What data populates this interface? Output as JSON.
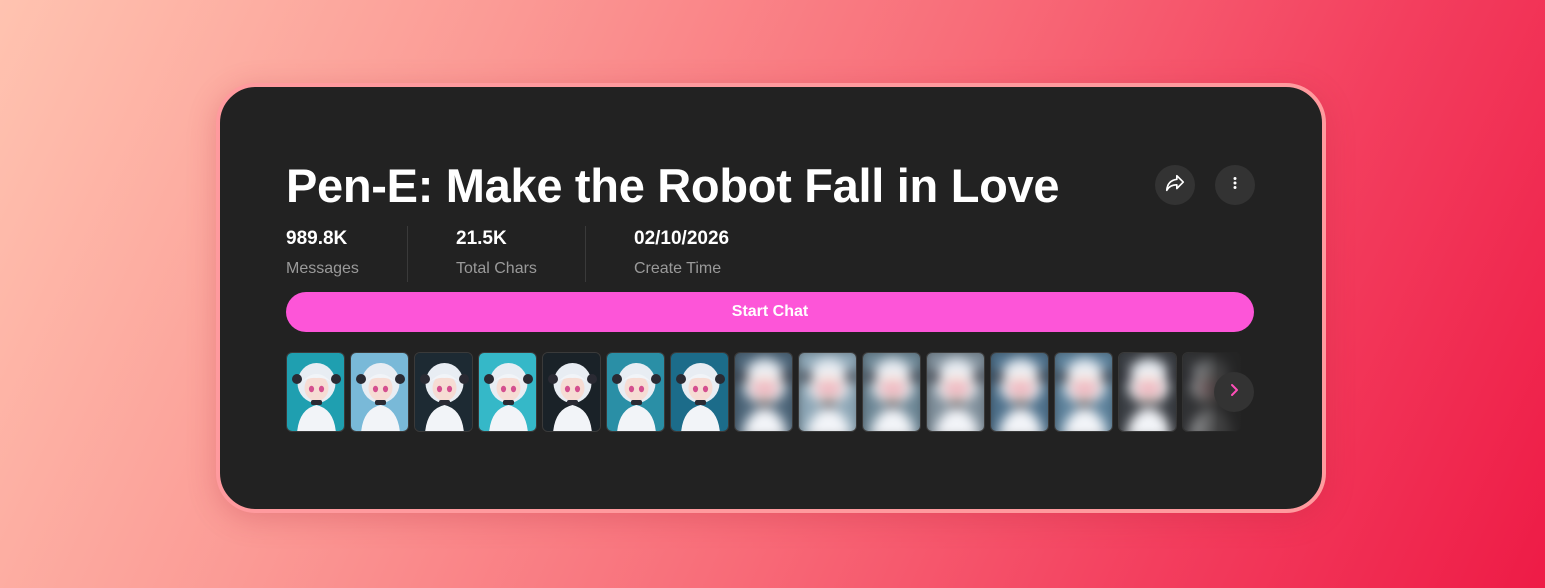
{
  "title": "Pen-E: Make the Robot Fall in Love",
  "actions": {
    "share_icon": "share-icon",
    "more_icon": "more-vertical-icon"
  },
  "stats": [
    {
      "value": "989.8K",
      "label": "Messages"
    },
    {
      "value": "21.5K",
      "label": "Total Chars"
    },
    {
      "value": "02/10/2026",
      "label": "Create Time"
    }
  ],
  "start_button": {
    "label": "Start Chat"
  },
  "gallery": {
    "next_icon": "chevron-right-icon",
    "thumbnails": [
      {
        "bg": "#1f9fb0",
        "blurred": false
      },
      {
        "bg": "#79b9d8",
        "blurred": false
      },
      {
        "bg": "#1d2a33",
        "blurred": false
      },
      {
        "bg": "#35b8c8",
        "blurred": false
      },
      {
        "bg": "#1a2228",
        "blurred": false
      },
      {
        "bg": "#2a8fa6",
        "blurred": false
      },
      {
        "bg": "#1c6c8a",
        "blurred": false
      },
      {
        "bg": "#4b6478",
        "blurred": true
      },
      {
        "bg": "#8aa4b4",
        "blurred": true
      },
      {
        "bg": "#6b8594",
        "blurred": true
      },
      {
        "bg": "#7c8c98",
        "blurred": true
      },
      {
        "bg": "#4c6f8a",
        "blurred": true
      },
      {
        "bg": "#5a7f99",
        "blurred": true
      },
      {
        "bg": "#3a3e44",
        "blurred": true
      },
      {
        "bg": "#3a3c40",
        "blurred": true
      }
    ]
  },
  "colors": {
    "accent": "#fd55d8",
    "card_background": "#222222",
    "card_border": "#ff9a9e",
    "chevron": "#ff4fb8"
  }
}
